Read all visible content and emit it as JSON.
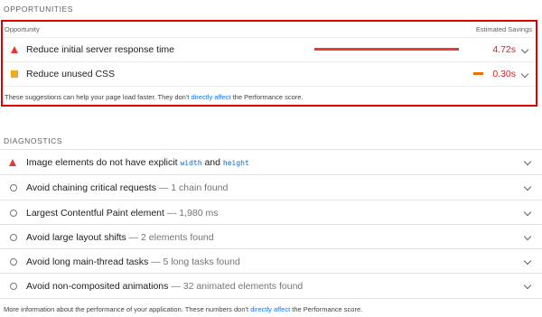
{
  "opportunities": {
    "section_title": "OPPORTUNITIES",
    "col_opportunity": "Opportunity",
    "col_savings": "Estimated Savings",
    "items": [
      {
        "title": "Reduce initial server response time",
        "savings": "4.72s",
        "icon": "warning-triangle-icon",
        "bar_fraction": 0.94,
        "color": "#e53935"
      },
      {
        "title": "Reduce unused CSS",
        "savings": "0.30s",
        "icon": "average-square-icon",
        "bar_fraction": 0.06,
        "color": "#e8710a"
      }
    ],
    "footer": {
      "pre": "These suggestions can help your page load faster. They don't ",
      "link": "directly affect",
      "post": " the Performance score."
    }
  },
  "diagnostics": {
    "section_title": "DIAGNOSTICS",
    "items": [
      {
        "title_pre": "Image elements do not have explicit ",
        "code1": "width",
        "mid": " and ",
        "code2": "height",
        "icon": "warning-triangle-icon"
      },
      {
        "title": "Avoid chaining critical requests",
        "detail": " — 1 chain found",
        "icon": "info-circle-icon"
      },
      {
        "title": "Largest Contentful Paint element",
        "detail": " — 1,980 ms",
        "icon": "info-circle-icon"
      },
      {
        "title": "Avoid large layout shifts",
        "detail": " — 2 elements found",
        "icon": "info-circle-icon"
      },
      {
        "title": "Avoid long main-thread tasks",
        "detail": " — 5 long tasks found",
        "icon": "info-circle-icon"
      },
      {
        "title": "Avoid non-composited animations",
        "detail": " — 32 animated elements found",
        "icon": "info-circle-icon"
      }
    ],
    "footer": {
      "pre": "More information about the performance of your application. These numbers don't ",
      "link": "directly affect",
      "post": " the Performance score."
    }
  },
  "colors": {
    "fail": "#e53935",
    "average": "#f5a623",
    "highlight_border": "#e00000",
    "link": "#1a73e8"
  }
}
